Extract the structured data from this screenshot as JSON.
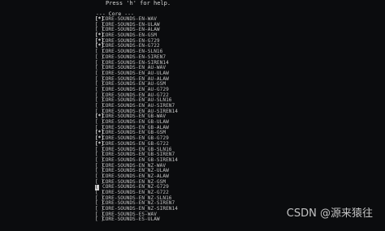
{
  "terminal": {
    "help_text": "Press 'h' for help.",
    "section_title": "--- Core ---"
  },
  "packages": [
    {
      "mark": "[*]",
      "name": "CORE-SOUNDS-EN-WAV"
    },
    {
      "mark": "[ ]",
      "name": "CORE-SOUNDS-EN-ULAW"
    },
    {
      "mark": "[ ]",
      "name": "CORE-SOUNDS-EN-ALAW"
    },
    {
      "mark": "[*]",
      "name": "CORE-SOUNDS-EN-GSM"
    },
    {
      "mark": "[*]",
      "name": "CORE-SOUNDS-EN-G729"
    },
    {
      "mark": "[*]",
      "name": "CORE-SOUNDS-EN-G722"
    },
    {
      "mark": "[ ]",
      "name": "CORE-SOUNDS-EN-SLN16"
    },
    {
      "mark": "[ ]",
      "name": "CORE-SOUNDS-EN-SIREN7"
    },
    {
      "mark": "[ ]",
      "name": "CORE-SOUNDS-EN-SIREN14"
    },
    {
      "mark": "[ ]",
      "name": "CORE-SOUNDS-EN_AU-WAV"
    },
    {
      "mark": "[ ]",
      "name": "CORE-SOUNDS-EN_AU-ULAW"
    },
    {
      "mark": "[ ]",
      "name": "CORE-SOUNDS-EN_AU-ALAW"
    },
    {
      "mark": "[ ]",
      "name": "CORE-SOUNDS-EN_AU-GSM"
    },
    {
      "mark": "[ ]",
      "name": "CORE-SOUNDS-EN_AU-G729"
    },
    {
      "mark": "[ ]",
      "name": "CORE-SOUNDS-EN_AU-G722"
    },
    {
      "mark": "[ ]",
      "name": "CORE-SOUNDS-EN_AU-SLN16"
    },
    {
      "mark": "[ ]",
      "name": "CORE-SOUNDS-EN_AU-SIREN7"
    },
    {
      "mark": "[ ]",
      "name": "CORE-SOUNDS-EN_AU-SIREN14"
    },
    {
      "mark": "[*]",
      "name": "CORE-SOUNDS-EN_GB-WAV"
    },
    {
      "mark": "[ ]",
      "name": "CORE-SOUNDS-EN_GB-ULAW"
    },
    {
      "mark": "[ ]",
      "name": "CORE-SOUNDS-EN_GB-ALAW"
    },
    {
      "mark": "[*]",
      "name": "CORE-SOUNDS-EN_GB-GSM"
    },
    {
      "mark": "[*]",
      "name": "CORE-SOUNDS-EN_GB-G729"
    },
    {
      "mark": "[*]",
      "name": "CORE-SOUNDS-EN_GB-G722"
    },
    {
      "mark": "[ ]",
      "name": "CORE-SOUNDS-EN_GB-SLN16"
    },
    {
      "mark": "[ ]",
      "name": "CORE-SOUNDS-EN_GB-SIREN7"
    },
    {
      "mark": "[ ]",
      "name": "CORE-SOUNDS-EN_GB-SIREN14"
    },
    {
      "mark": "[ ]",
      "name": "CORE-SOUNDS-EN_NZ-WAV"
    },
    {
      "mark": "[ ]",
      "name": "CORE-SOUNDS-EN_NZ-ULAW"
    },
    {
      "mark": "[ ]",
      "name": "CORE-SOUNDS-EN_NZ-ALAW"
    },
    {
      "mark": "[ ]",
      "name": "CORE-SOUNDS-EN_NZ-GSM"
    },
    {
      "mark": "[ ]",
      "name": "CORE-SOUNDS-EN_NZ-G729"
    },
    {
      "mark": "[ ]",
      "name": "CORE-SOUNDS-EN_NZ-G722"
    },
    {
      "mark": "[ ]",
      "name": "CORE-SOUNDS-EN_NZ-SLN16"
    },
    {
      "mark": "[ ]",
      "name": "CORE-SOUNDS-EN_NZ-SIREN7"
    },
    {
      "mark": "[ ]",
      "name": "CORE-SOUNDS-EN_NZ-SIREN14"
    },
    {
      "mark": "[ ]",
      "name": "CORE-SOUNDS-ES-WAV"
    },
    {
      "mark": "[ ]",
      "name": "CORE-SOUNDS-ES-ULAW"
    }
  ],
  "cursor_row": 31,
  "watermark": "CSDN @源来猿往",
  "colors": {
    "background": "#0b0c0e",
    "text": "#c9c9c9",
    "cursor": "#d0d0d0"
  }
}
